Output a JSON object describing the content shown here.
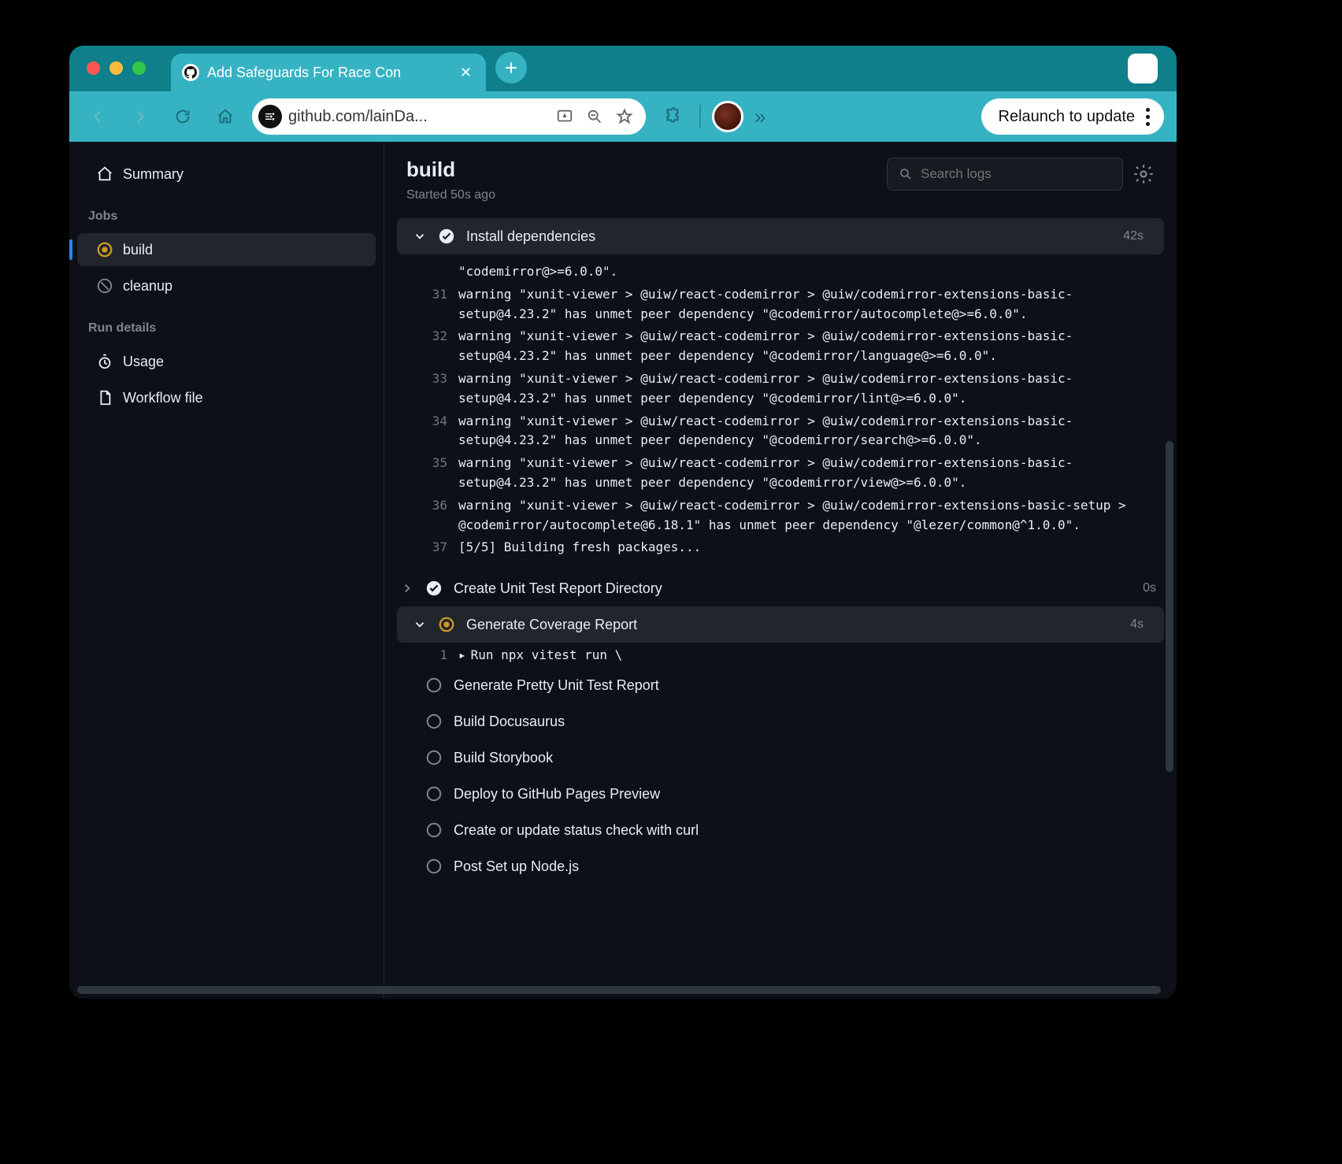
{
  "tab": {
    "title": "Add Safeguards For Race Con"
  },
  "omnibox": {
    "url": "github.com/lainDa..."
  },
  "toolbar": {
    "relaunch": "Relaunch to update"
  },
  "sidebar": {
    "summary": "Summary",
    "jobs_header": "Jobs",
    "jobs": [
      {
        "name": "build",
        "status": "running"
      },
      {
        "name": "cleanup",
        "status": "skipped"
      }
    ],
    "details_header": "Run details",
    "details": [
      {
        "name": "Usage"
      },
      {
        "name": "Workflow file"
      }
    ]
  },
  "job": {
    "title": "build",
    "subtitle": "Started 50s ago"
  },
  "search": {
    "placeholder": "Search logs"
  },
  "steps": {
    "install": {
      "label": "Install dependencies",
      "duration": "42s"
    },
    "logs_first": "\"codemirror@>=6.0.0\".",
    "logs": [
      {
        "n": "31",
        "text": "warning \"xunit-viewer > @uiw/react-codemirror > @uiw/codemirror-extensions-basic-setup@4.23.2\" has unmet peer dependency \"@codemirror/autocomplete@>=6.0.0\"."
      },
      {
        "n": "32",
        "text": "warning \"xunit-viewer > @uiw/react-codemirror > @uiw/codemirror-extensions-basic-setup@4.23.2\" has unmet peer dependency \"@codemirror/language@>=6.0.0\"."
      },
      {
        "n": "33",
        "text": "warning \"xunit-viewer > @uiw/react-codemirror > @uiw/codemirror-extensions-basic-setup@4.23.2\" has unmet peer dependency \"@codemirror/lint@>=6.0.0\"."
      },
      {
        "n": "34",
        "text": "warning \"xunit-viewer > @uiw/react-codemirror > @uiw/codemirror-extensions-basic-setup@4.23.2\" has unmet peer dependency \"@codemirror/search@>=6.0.0\"."
      },
      {
        "n": "35",
        "text": "warning \"xunit-viewer > @uiw/react-codemirror > @uiw/codemirror-extensions-basic-setup@4.23.2\" has unmet peer dependency \"@codemirror/view@>=6.0.0\"."
      },
      {
        "n": "36",
        "text": "warning \"xunit-viewer > @uiw/react-codemirror > @uiw/codemirror-extensions-basic-setup > @codemirror/autocomplete@6.18.1\" has unmet peer dependency \"@lezer/common@^1.0.0\"."
      },
      {
        "n": "37",
        "text": "[5/5] Building fresh packages..."
      }
    ],
    "create_report": {
      "label": "Create Unit Test Report Directory",
      "duration": "0s"
    },
    "coverage": {
      "label": "Generate Coverage Report",
      "duration": "4s",
      "run_n": "1",
      "run_cmd": "Run npx vitest run \\"
    },
    "pending": [
      "Generate Pretty Unit Test Report",
      "Build Docusaurus",
      "Build Storybook",
      "Deploy to GitHub Pages Preview",
      "Create or update status check with curl",
      "Post Set up Node.js"
    ]
  }
}
